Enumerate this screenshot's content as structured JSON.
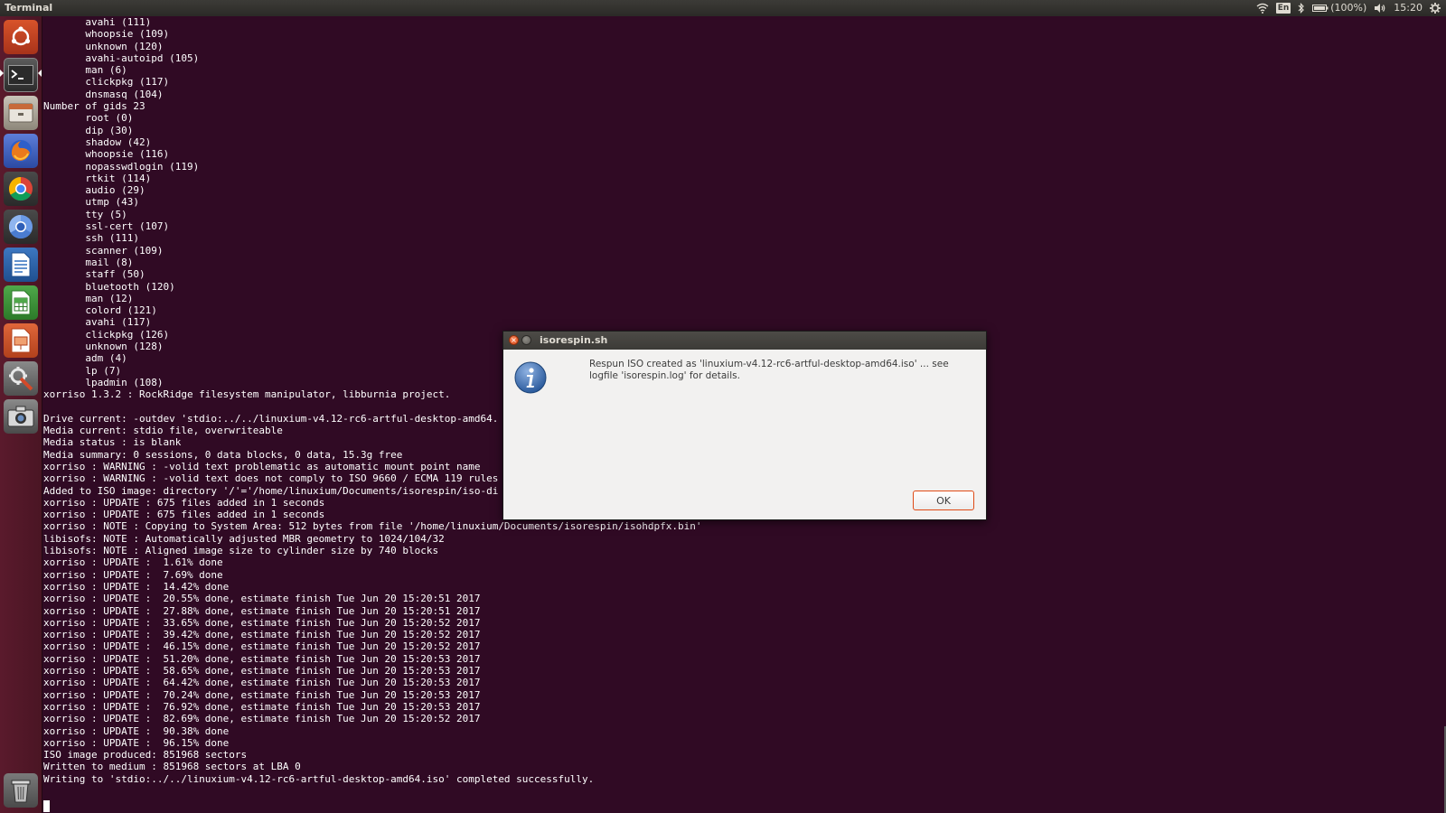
{
  "top_panel": {
    "app_title": "Terminal",
    "language": "En",
    "battery": "(100%)",
    "clock": "15:20",
    "icons": [
      "wifi-icon",
      "bluetooth-icon",
      "battery-icon",
      "volume-icon",
      "gear-icon"
    ]
  },
  "launcher": {
    "items": [
      {
        "name": "ubuntu-dash-icon"
      },
      {
        "name": "terminal-icon",
        "active": true
      },
      {
        "name": "files-icon"
      },
      {
        "name": "firefox-icon"
      },
      {
        "name": "chrome-icon"
      },
      {
        "name": "chromium-icon"
      },
      {
        "name": "libreoffice-writer-icon"
      },
      {
        "name": "libreoffice-calc-icon"
      },
      {
        "name": "libreoffice-impress-icon"
      },
      {
        "name": "system-settings-icon"
      },
      {
        "name": "camera-icon"
      },
      {
        "name": "trash-icon"
      }
    ]
  },
  "terminal": {
    "lines": [
      "       avahi (111)",
      "       whoopsie (109)",
      "       unknown (120)",
      "       avahi-autoipd (105)",
      "       man (6)",
      "       clickpkg (117)",
      "       dnsmasq (104)",
      "Number of gids 23",
      "       root (0)",
      "       dip (30)",
      "       shadow (42)",
      "       whoopsie (116)",
      "       nopasswdlogin (119)",
      "       rtkit (114)",
      "       audio (29)",
      "       utmp (43)",
      "       tty (5)",
      "       ssl-cert (107)",
      "       ssh (111)",
      "       scanner (109)",
      "       mail (8)",
      "       staff (50)",
      "       bluetooth (120)",
      "       man (12)",
      "       colord (121)",
      "       avahi (117)",
      "       clickpkg (126)",
      "       unknown (128)",
      "       adm (4)",
      "       lp (7)",
      "       lpadmin (108)",
      "xorriso 1.3.2 : RockRidge filesystem manipulator, libburnia project.",
      "",
      "Drive current: -outdev 'stdio:../../linuxium-v4.12-rc6-artful-desktop-amd64.",
      "Media current: stdio file, overwriteable",
      "Media status : is blank",
      "Media summary: 0 sessions, 0 data blocks, 0 data, 15.3g free",
      "xorriso : WARNING : -volid text problematic as automatic mount point name",
      "xorriso : WARNING : -volid text does not comply to ISO 9660 / ECMA 119 rules",
      "Added to ISO image: directory '/'='/home/linuxium/Documents/isorespin/iso-di",
      "xorriso : UPDATE : 675 files added in 1 seconds",
      "xorriso : UPDATE : 675 files added in 1 seconds",
      "xorriso : NOTE : Copying to System Area: 512 bytes from file '/home/linuxium/Documents/isorespin/isohdpfx.bin'",
      "libisofs: NOTE : Automatically adjusted MBR geometry to 1024/104/32",
      "libisofs: NOTE : Aligned image size to cylinder size by 740 blocks",
      "xorriso : UPDATE :  1.61% done",
      "xorriso : UPDATE :  7.69% done",
      "xorriso : UPDATE :  14.42% done",
      "xorriso : UPDATE :  20.55% done, estimate finish Tue Jun 20 15:20:51 2017",
      "xorriso : UPDATE :  27.88% done, estimate finish Tue Jun 20 15:20:51 2017",
      "xorriso : UPDATE :  33.65% done, estimate finish Tue Jun 20 15:20:52 2017",
      "xorriso : UPDATE :  39.42% done, estimate finish Tue Jun 20 15:20:52 2017",
      "xorriso : UPDATE :  46.15% done, estimate finish Tue Jun 20 15:20:52 2017",
      "xorriso : UPDATE :  51.20% done, estimate finish Tue Jun 20 15:20:53 2017",
      "xorriso : UPDATE :  58.65% done, estimate finish Tue Jun 20 15:20:53 2017",
      "xorriso : UPDATE :  64.42% done, estimate finish Tue Jun 20 15:20:53 2017",
      "xorriso : UPDATE :  70.24% done, estimate finish Tue Jun 20 15:20:53 2017",
      "xorriso : UPDATE :  76.92% done, estimate finish Tue Jun 20 15:20:53 2017",
      "xorriso : UPDATE :  82.69% done, estimate finish Tue Jun 20 15:20:52 2017",
      "xorriso : UPDATE :  90.38% done",
      "xorriso : UPDATE :  96.15% done",
      "ISO image produced: 851968 sectors",
      "Written to medium : 851968 sectors at LBA 0",
      "Writing to 'stdio:../../linuxium-v4.12-rc6-artful-desktop-amd64.iso' completed successfully."
    ]
  },
  "dialog": {
    "title": "isorespin.sh",
    "message": "Respun ISO created as 'linuxium-v4.12-rc6-artful-desktop-amd64.iso' ... see logfile 'isorespin.log' for details.",
    "ok_label": "OK",
    "icon": "info-icon"
  },
  "colors": {
    "terminal_bg": "#300a24",
    "panel_bg": "#3c3b37",
    "accent": "#df4a16",
    "dialog_bg": "#f2f1f0",
    "info_blue": "#3465a4"
  }
}
